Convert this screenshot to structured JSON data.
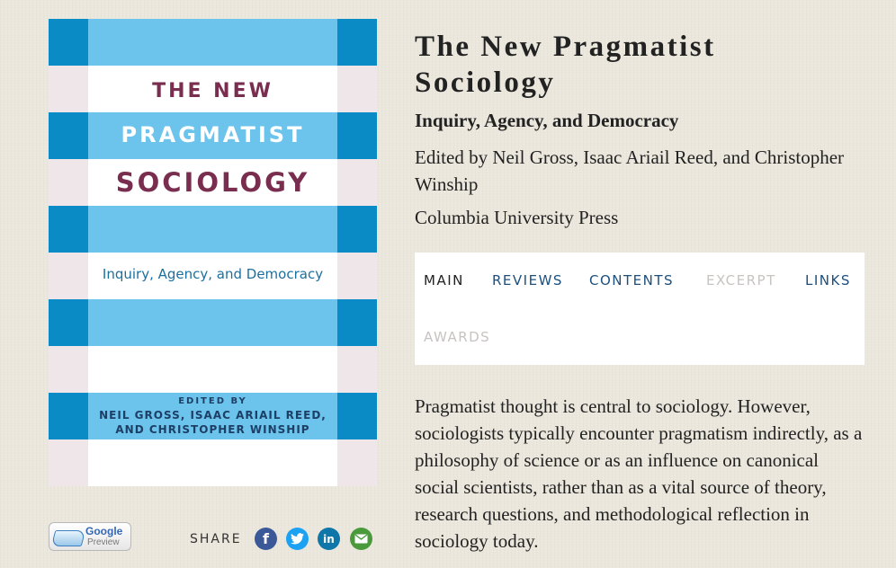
{
  "book": {
    "title": "The New Pragmatist Sociology",
    "subtitle": "Inquiry, Agency, and Democracy",
    "editors": "Edited by Neil Gross, Isaac Ariail Reed, and Christopher Winship",
    "publisher": "Columbia University Press"
  },
  "cover": {
    "line1": "THE NEW",
    "line2": "PRAGMATIST",
    "line3": "SOCIOLOGY",
    "subtitle": "Inquiry, Agency, and Democracy",
    "edited_by": "EDITED BY",
    "names1": "NEIL GROSS, ISAAC ARIAIL REED,",
    "names2": "AND CHRISTOPHER WINSHIP",
    "colors": {
      "light_blue": "#6cc3eb",
      "dark_blue": "#0a8bc6",
      "maroon": "#7a2e4f",
      "pink_white": "#efe6e9"
    }
  },
  "tabs": [
    {
      "label": "MAIN",
      "state": "active"
    },
    {
      "label": "REVIEWS",
      "state": "link"
    },
    {
      "label": "CONTENTS",
      "state": "link"
    },
    {
      "label": "EXCERPT",
      "state": "disabled"
    },
    {
      "label": "LINKS",
      "state": "link"
    },
    {
      "label": "AWARDS",
      "state": "disabled"
    }
  ],
  "description": "Pragmatist thought is central to sociology. However, sociologists typically encounter pragmatism indirectly, as a philosophy of science or as an influence on canonical social scientists, rather than as a vital source of theory, research questions, and methodological reflection in sociology today.",
  "google_preview": {
    "brand": "Google",
    "label": "Preview"
  },
  "share": {
    "label": "SHARE",
    "icons": [
      "facebook-icon",
      "twitter-icon",
      "linkedin-icon",
      "email-icon"
    ]
  }
}
